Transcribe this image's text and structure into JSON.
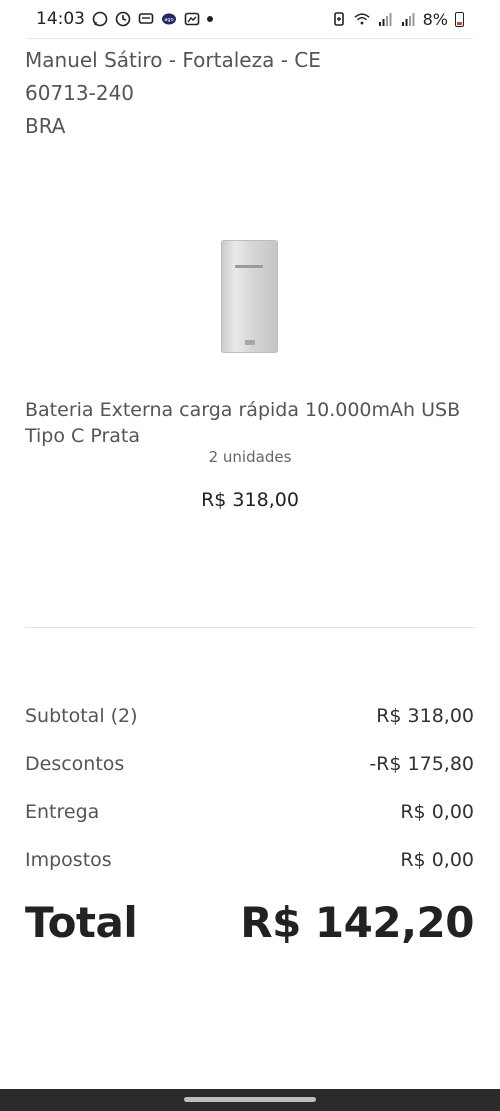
{
  "status_bar": {
    "time": "14:03",
    "battery_percent": "8%",
    "icons": [
      "whatsapp-icon",
      "clock-app-icon",
      "chat-icon",
      "app-icon",
      "photo-icon",
      "notification-dot-icon",
      "battery-saver-icon",
      "wifi-icon",
      "signal-icon",
      "signal-icon-2",
      "battery-icon"
    ]
  },
  "address": {
    "line1": "Manuel Sátiro - Fortaleza - CE",
    "line2": "60713-240",
    "line3": "BRA"
  },
  "product": {
    "name": "Bateria Externa carga rápida 10.000mAh USB Tipo C Prata",
    "units": "2 unidades",
    "price": "R$ 318,00"
  },
  "summary": {
    "subtotal_label": "Subtotal (2)",
    "subtotal_value": "R$ 318,00",
    "discounts_label": "Descontos",
    "discounts_value": "-R$ 175,80",
    "shipping_label": "Entrega",
    "shipping_value": "R$ 0,00",
    "taxes_label": "Impostos",
    "taxes_value": "R$ 0,00",
    "total_label": "Total",
    "total_value": "R$ 142,20"
  },
  "colors": {
    "text_primary": "#222222",
    "text_secondary": "#555555",
    "battery_low": "#e53935",
    "nav_bar": "#2b2b2b"
  }
}
